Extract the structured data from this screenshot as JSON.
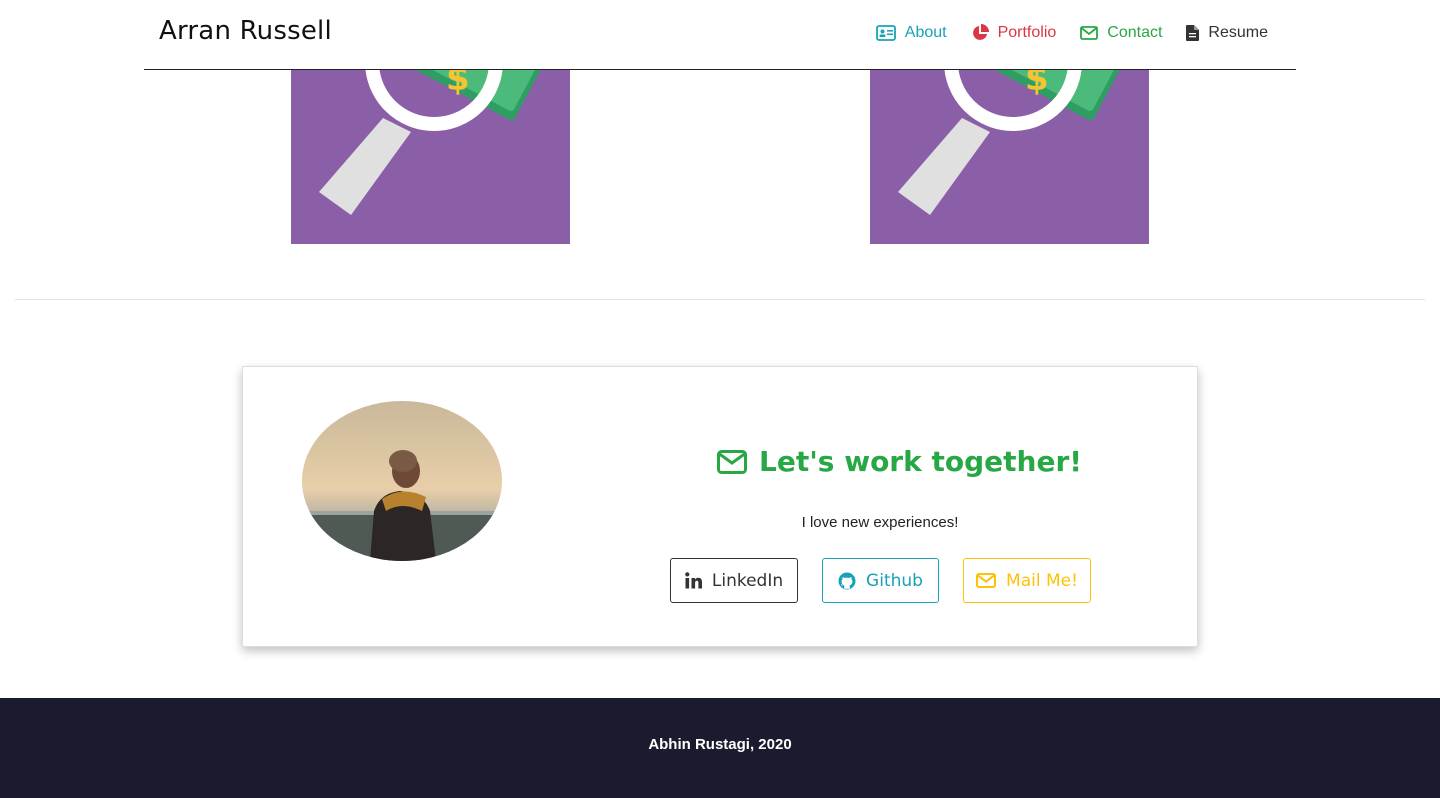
{
  "navbar": {
    "brand": "Arran Russell",
    "items": [
      {
        "label": "About",
        "icon": "id-card-icon",
        "color": "#17a2b8"
      },
      {
        "label": "Portfolio",
        "icon": "pie-chart-icon",
        "color": "#dc3545"
      },
      {
        "label": "Contact",
        "icon": "envelope-icon",
        "color": "#28a745"
      },
      {
        "label": "Resume",
        "icon": "file-icon",
        "color": "#333333"
      }
    ]
  },
  "portfolio": {
    "thumbnail_color": "#8a5fa8",
    "thumbnails": [
      {
        "icon": "magnifier-money-icon"
      },
      {
        "icon": "magnifier-money-icon"
      }
    ]
  },
  "contact_card": {
    "title": "Let's work together!",
    "title_icon": "envelope-icon",
    "text": "I love new experiences!",
    "buttons": {
      "linkedin": "LinkedIn",
      "github": "Github",
      "mail": "Mail Me!"
    }
  },
  "footer": {
    "text": "Abhin Rustagi, 2020",
    "background": "#1b1b2f"
  }
}
